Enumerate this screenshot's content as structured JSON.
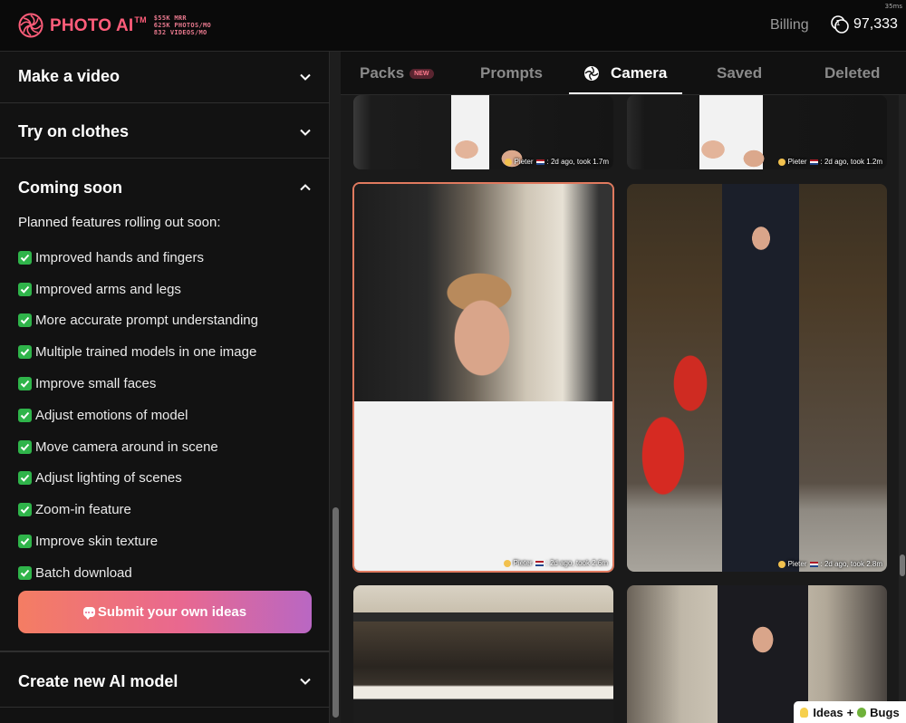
{
  "header": {
    "logo_text": "PHOTO AI",
    "logo_tm": "TM",
    "stats": [
      "$55K MRR",
      "625K PHOTOS/MO",
      "832 VIDEOS/MO"
    ],
    "latency": "35ms",
    "billing_label": "Billing",
    "credits": "97,333"
  },
  "sidebar": {
    "sections": {
      "video": {
        "title": "Make a video",
        "state": "collapsed"
      },
      "clothes": {
        "title": "Try on clothes",
        "state": "collapsed"
      },
      "coming": {
        "title": "Coming soon",
        "state": "expanded"
      },
      "model": {
        "title": "Create new AI model",
        "state": "collapsed"
      }
    },
    "intro": "Planned features rolling out soon:",
    "features": [
      "Improved hands and fingers",
      "Improved arms and legs",
      "More accurate prompt understanding",
      "Multiple trained models in one image",
      "Improve small faces",
      "Adjust emotions of model",
      "Move camera around in scene",
      "Adjust lighting of scenes",
      "Zoom-in feature",
      "Improve skin texture",
      "Batch download"
    ],
    "submit_label": "Submit your own ideas"
  },
  "tabs": {
    "packs": "Packs",
    "packs_badge": "NEW",
    "prompts": "Prompts",
    "camera": "Camera",
    "saved": "Saved",
    "deleted": "Deleted",
    "active": "Camera"
  },
  "gallery": [
    {
      "user": "Pieter",
      "meta": ": 2d ago, took 1.7m"
    },
    {
      "user": "Pieter",
      "meta": ": 2d ago, took 1.2m"
    },
    {
      "user": "Pieter",
      "meta": ": 2d ago, took 2.6m",
      "selected": true
    },
    {
      "user": "Pieter",
      "meta": ": 2d ago, took 2.8m"
    },
    {
      "user": "",
      "meta": ""
    },
    {
      "user": "",
      "meta": ""
    }
  ],
  "feedback_button": {
    "ideas": "Ideas",
    "plus": "+",
    "bugs": "Bugs"
  },
  "colors": {
    "brand": "#ff5d7a",
    "check": "#2fb44a",
    "selected_border": "#e07a5f",
    "button_gradient": [
      "#f47d63",
      "#e9688f",
      "#b967c3"
    ]
  }
}
